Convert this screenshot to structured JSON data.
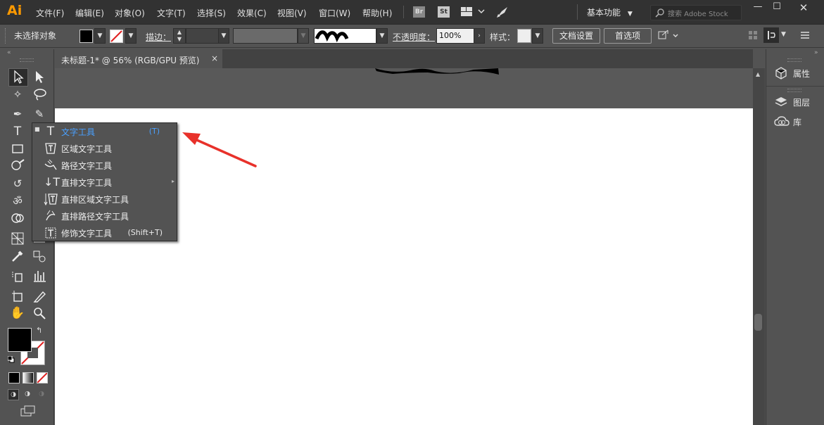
{
  "app": {
    "logo": "Ai"
  },
  "menubar": {
    "items": [
      "文件(F)",
      "编辑(E)",
      "对象(O)",
      "文字(T)",
      "选择(S)",
      "效果(C)",
      "视图(V)",
      "窗口(W)",
      "帮助(H)"
    ],
    "badges": [
      "Br",
      "St"
    ],
    "workspace": "基本功能",
    "search_placeholder": "搜索 Adobe Stock"
  },
  "control_bar": {
    "selection_label": "未选择对象",
    "stroke_label": "描边：",
    "opacity_label": "不透明度：",
    "opacity_value": "100%",
    "style_label": "样式：",
    "doc_setup_button": "文档设置",
    "preferences_button": "首选项"
  },
  "document_tab": {
    "title": "未标题-1* @ 56% (RGB/GPU 预览)",
    "close": "×"
  },
  "text_tool_flyout": {
    "items": [
      {
        "label": "文字工具",
        "shortcut": "(T)"
      },
      {
        "label": "区域文字工具",
        "shortcut": ""
      },
      {
        "label": "路径文字工具",
        "shortcut": ""
      },
      {
        "label": "直排文字工具",
        "shortcut": ""
      },
      {
        "label": "直排区域文字工具",
        "shortcut": ""
      },
      {
        "label": "直排路径文字工具",
        "shortcut": ""
      },
      {
        "label": "修饰文字工具",
        "shortcut": "(Shift+T)"
      }
    ]
  },
  "right_panel": {
    "items": [
      "属性",
      "图层",
      "库"
    ]
  },
  "colors": {
    "accent": "#4aa0ff",
    "logo": "#ff9a00",
    "annotation_arrow": "#e8312a"
  }
}
